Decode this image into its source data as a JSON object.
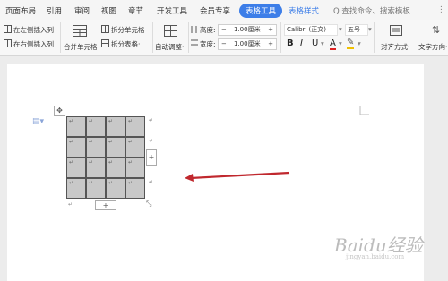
{
  "tabs": {
    "page_layout": "页面布局",
    "references": "引用",
    "review": "审阅",
    "view": "视图",
    "sections": "章节",
    "developer": "开发工具",
    "member": "会员专享",
    "table_tools": "表格工具",
    "table_style": "表格样式",
    "search": "Q 查找命令、搜索模板"
  },
  "ribbon": {
    "insert_left": "在左侧插入列",
    "insert_right": "在右侧插入列",
    "merge_cells": "合并单元格",
    "split_cells": "拆分单元格",
    "split_table": "拆分表格·",
    "autofit": "自动调整·",
    "height_label": "高度:",
    "height_value": "1.00厘米",
    "width_label": "宽度:",
    "width_value": "1.00厘米",
    "font_name": "Calibri (正文)",
    "font_size": "五号",
    "align": "对齐方式·",
    "text_dir": "文字方向·",
    "minus": "−",
    "plus": "+"
  },
  "document": {
    "cell_mark": "↵",
    "row_add": "+",
    "col_add": "+"
  },
  "watermark": {
    "text": "Baidu经验",
    "sub": "jingyan.baidu.com"
  },
  "colors": {
    "accent": "#3d7ee8",
    "arrow": "#c0282e",
    "cell_fill": "#c8c8c8"
  }
}
